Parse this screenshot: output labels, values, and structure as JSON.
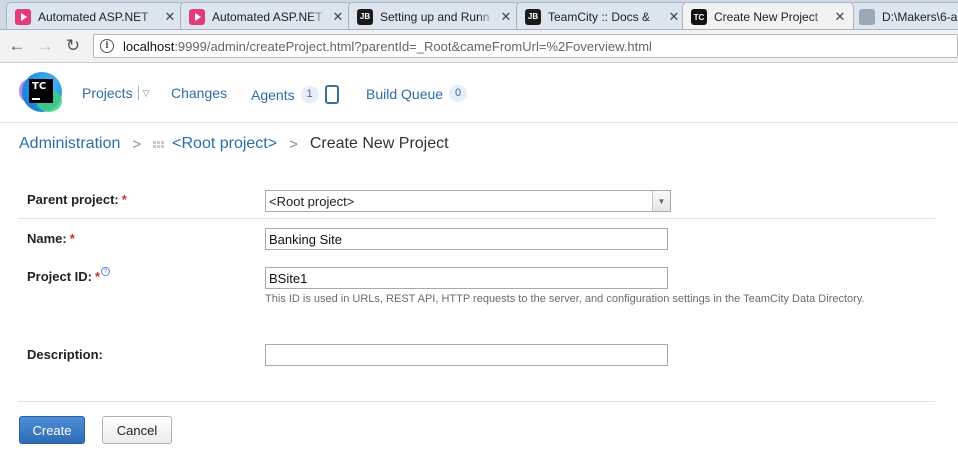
{
  "browser": {
    "tabs": [
      {
        "title": "Automated ASP.NET",
        "favicon": "pluralsight-icon",
        "active": false
      },
      {
        "title": "Automated ASP.NET",
        "favicon": "pluralsight-icon",
        "active": false
      },
      {
        "title": "Setting up and Runn",
        "favicon": "jetbrains-icon",
        "active": false
      },
      {
        "title": "TeamCity :: Docs &",
        "favicon": "jetbrains-icon",
        "active": false
      },
      {
        "title": "Create New Project",
        "favicon": "teamcity-icon",
        "active": true
      },
      {
        "title": "D:\\Makers\\6-a",
        "favicon": "file-icon",
        "active": false
      }
    ],
    "close_glyph": "✕",
    "address": {
      "host": "localhost",
      "rest": ":9999/admin/createProject.html?parentId=_Root&cameFromUrl=%2Foverview.html"
    }
  },
  "header": {
    "logo_text": "TC",
    "nav": {
      "projects": "Projects",
      "changes": "Changes",
      "agents": "Agents",
      "agents_count": "1",
      "build_queue": "Build Queue",
      "build_queue_count": "0"
    }
  },
  "breadcrumb": {
    "administration": "Administration",
    "root_project": "<Root project>",
    "current": "Create New Project",
    "separator": ">"
  },
  "form": {
    "parent_project": {
      "label": "Parent project:",
      "required_mark": "*",
      "value": "<Root project>"
    },
    "name": {
      "label": "Name:",
      "required_mark": "*",
      "value": "Banking Site"
    },
    "project_id": {
      "label": "Project ID:",
      "required_mark": "*",
      "value": "BSite1",
      "hint": "This ID is used in URLs, REST API, HTTP requests to the server, and configuration settings in the TeamCity Data Directory."
    },
    "description": {
      "label": "Description:",
      "value": ""
    }
  },
  "actions": {
    "create": "Create",
    "cancel": "Cancel"
  },
  "colors": {
    "link": "#2f6ca8",
    "required": "#c63131",
    "primary_button": "#2e6cb7"
  }
}
